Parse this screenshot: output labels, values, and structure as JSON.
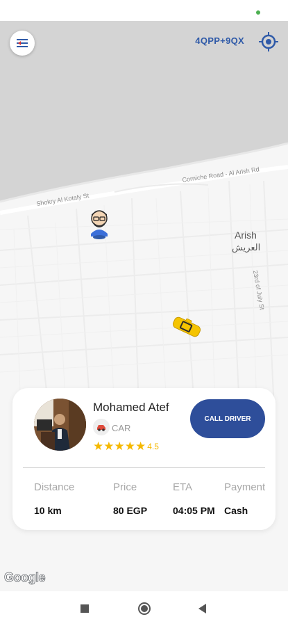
{
  "map": {
    "plus_code": "4QPP+9QX",
    "street_1": "Shokry Al Kotaly St",
    "street_2": "Corniche Road - Al Arish Rd",
    "street_3": "23rd of July St",
    "city_en": "Arish",
    "city_ar": "العريش",
    "attribution": "Google",
    "icons": {
      "menu": "menu-toggle-icon",
      "locate": "gps-target-icon",
      "user": "user-avatar-pin-icon",
      "vehicle": "taxi-car-icon"
    }
  },
  "driver": {
    "name": "Mohamed Atef",
    "vehicle_type": "CAR",
    "rating_value": 4.5,
    "rating_text": "4.5",
    "call_button": "CALL DRIVER"
  },
  "trip": {
    "distance_label": "Distance",
    "distance_value": "10 km",
    "price_label": "Price",
    "price_value": "80 EGP",
    "eta_label": "ETA",
    "eta_value": "04:05 PM",
    "payment_label": "Payment",
    "payment_value": "Cash"
  },
  "colors": {
    "accent": "#2e4e9a",
    "star": "#f5b800",
    "sea": "#d4d4d4",
    "status_dot": "#4caf50"
  }
}
